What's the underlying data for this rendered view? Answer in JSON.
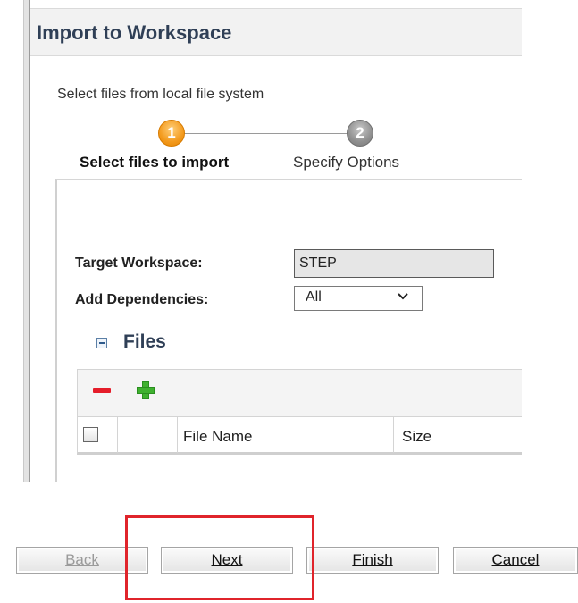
{
  "dialog": {
    "title": "Import to Workspace",
    "subtitle": "Select files from local file system"
  },
  "wizard": {
    "steps": [
      {
        "number": "1",
        "label": "Select files to import",
        "state": "active"
      },
      {
        "number": "2",
        "label": "Specify Options",
        "state": "inactive"
      }
    ]
  },
  "form": {
    "target_workspace_label": "Target Workspace:",
    "target_workspace_value": "STEP",
    "add_dependencies_label": "Add Dependencies:",
    "add_dependencies_value": "All"
  },
  "files": {
    "section_title": "Files",
    "toolbar": {
      "remove_icon": "remove-icon",
      "add_icon": "add-icon"
    },
    "columns": [
      "",
      "",
      "File Name",
      "Size"
    ],
    "rows": []
  },
  "footer": {
    "buttons": {
      "back": "Back",
      "next": "Next",
      "finish": "Finish",
      "cancel": "Cancel"
    }
  },
  "colors": {
    "accent_title": "#2f3f56",
    "step_active": "#f39a1d",
    "step_inactive": "#8f8f8f",
    "highlight": "#e0242b",
    "remove": "#e51d2a",
    "add": "#3fb12f"
  }
}
